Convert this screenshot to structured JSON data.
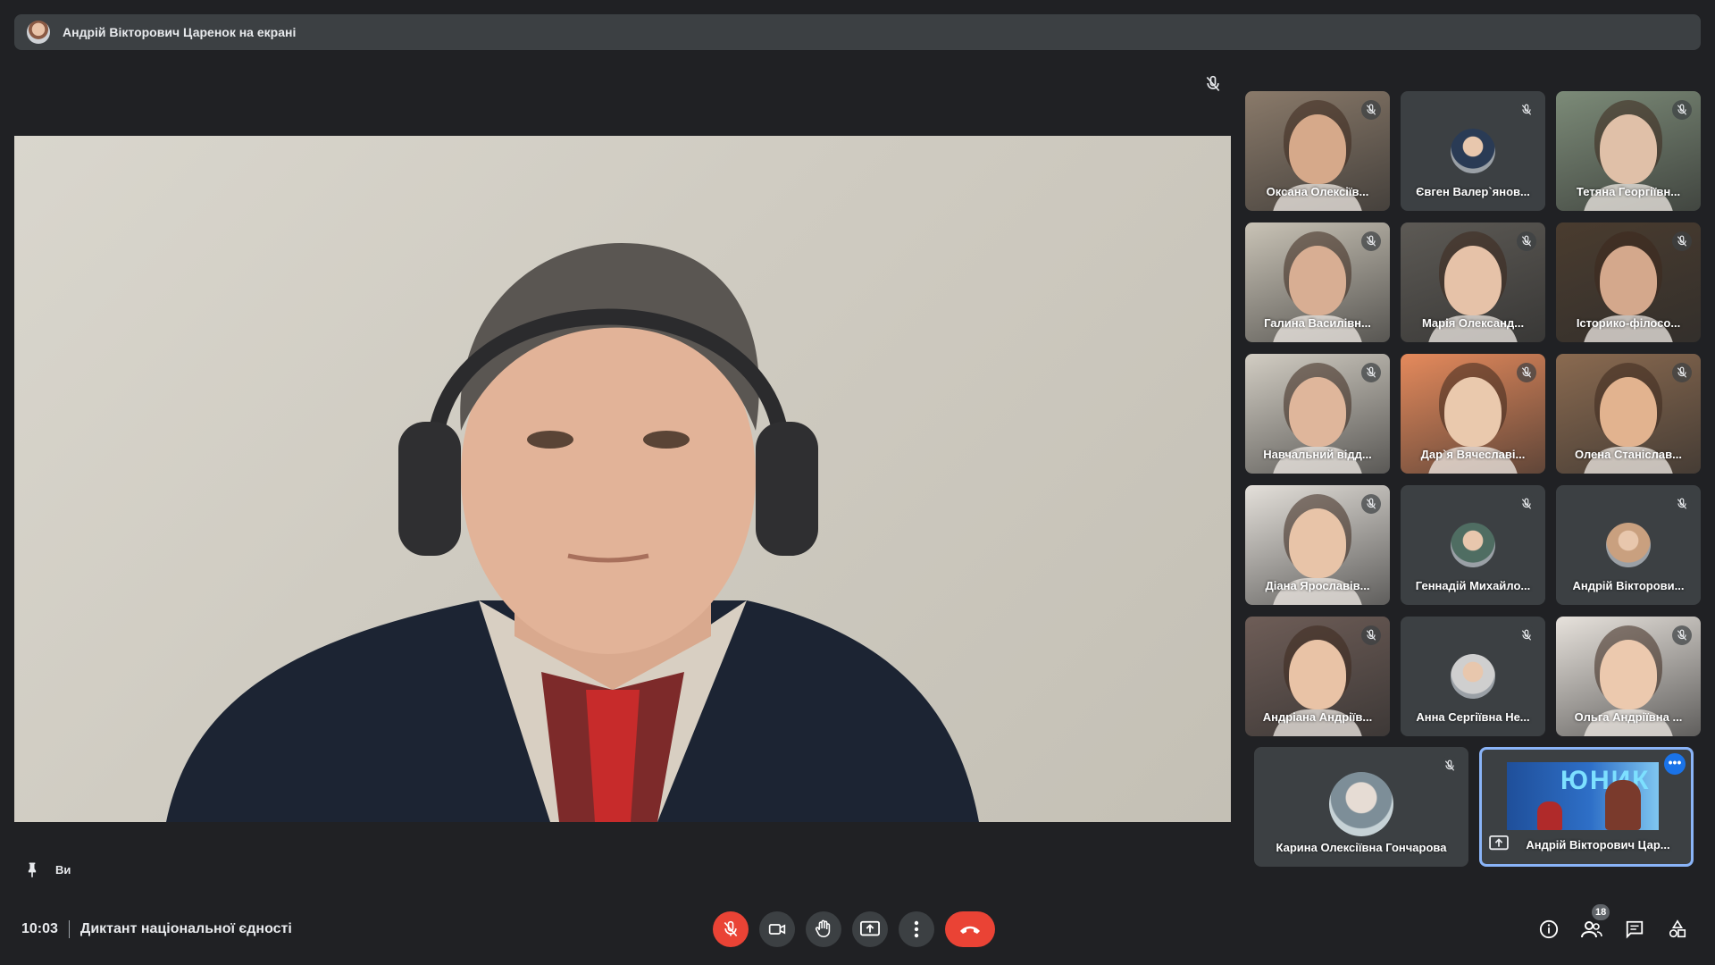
{
  "banner": {
    "text": "Андрій Вікторович Царенок на екрані"
  },
  "self": {
    "label": "Ви"
  },
  "participants": [
    {
      "name": "Оксана Олексіїв...",
      "bg": "#8a7a6a",
      "face": "#d6a98a"
    },
    {
      "name": "Євген Валер`янов...",
      "bg": "#3c4043",
      "avatar": true,
      "av": "#2a3b55"
    },
    {
      "name": "Тетяна Георгіївн...",
      "bg": "#7c8b78",
      "face": "#e0c0a8"
    },
    {
      "name": "Галина Василівн...",
      "bg": "#c9c3b6",
      "face": "#d8ae93"
    },
    {
      "name": "Марія Олександ...",
      "bg": "#5d5a55",
      "face": "#e6c2a8"
    },
    {
      "name": "Історико-філосо...",
      "bg": "#4a3c2f",
      "face": "#d4a88c"
    },
    {
      "name": "Навчальний відд...",
      "bg": "#d2cdc3",
      "face": "#dfb69b"
    },
    {
      "name": "Дар`я Вячеславі...",
      "bg": "#e58a5c",
      "face": "#eac9ad"
    },
    {
      "name": "Олена Станіслав...",
      "bg": "#8a6a50",
      "face": "#e2b38f"
    },
    {
      "name": "Діана Ярославів...",
      "bg": "#e4e0da",
      "face": "#e8c4a8"
    },
    {
      "name": "Геннадій Михайло...",
      "bg": "#3c4043",
      "avatar": true,
      "av": "#4f6d62"
    },
    {
      "name": "Андрій Вікторови...",
      "bg": "#3c4043",
      "avatar": true,
      "av": "#c9a07f"
    },
    {
      "name": "Андріана Андріїв...",
      "bg": "#6e5d57",
      "face": "#e9c3a6"
    },
    {
      "name": "Анна Сергіївна Не...",
      "bg": "#3c4043",
      "avatar": true,
      "av": "#cfcfcf"
    },
    {
      "name": "Ольга Андріївна ...",
      "bg": "#e7e2dc",
      "face": "#ecc9ae"
    }
  ],
  "wide_tile": {
    "name": "Карина Олексіївна Гончарова",
    "av": "#8aa4b0"
  },
  "present_tile": {
    "name": "Андрій Вікторович Цар...",
    "more": "•••",
    "screen_text": "ЮНИК"
  },
  "meeting": {
    "time": "10:03",
    "title": "Диктант національної єдності"
  },
  "people_count": "18",
  "colors": {
    "accent": "#8ab4f8",
    "danger": "#ea4335",
    "tile": "#3c4043",
    "bg": "#202124"
  },
  "icons": [
    "mic-off-icon",
    "camera-icon",
    "hand-icon",
    "present-icon",
    "more-icon",
    "hangup-icon",
    "info-icon",
    "people-icon",
    "chat-icon",
    "activities-icon",
    "pin-icon"
  ]
}
